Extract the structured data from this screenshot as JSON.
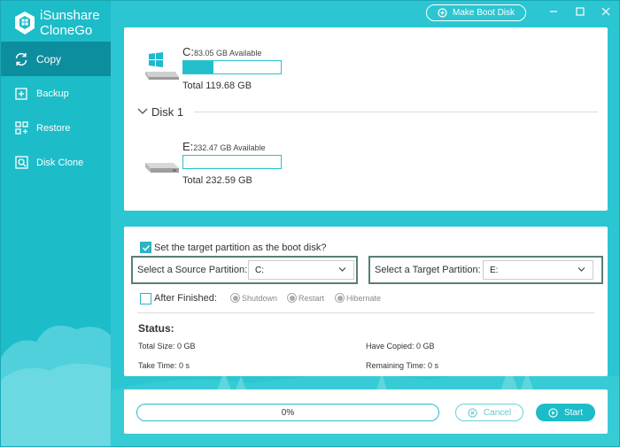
{
  "app": {
    "brand_line1": "iSunshare",
    "brand_line2": "CloneGo"
  },
  "sidebar": {
    "items": [
      {
        "label": "Copy",
        "icon": "copy-cycle-icon",
        "active": true
      },
      {
        "label": "Backup",
        "icon": "backup-plus-icon",
        "active": false
      },
      {
        "label": "Restore",
        "icon": "restore-grid-icon",
        "active": false
      },
      {
        "label": "Disk Clone",
        "icon": "disk-clone-icon",
        "active": false
      }
    ]
  },
  "topbar": {
    "boot_label": "Make Boot Disk"
  },
  "disks": {
    "c": {
      "letter": "C:",
      "available": "83.05 GB Available",
      "total": "Total 119.68 GB",
      "used_fraction": 0.31
    },
    "disk1_label": "Disk 1",
    "e": {
      "letter": "E:",
      "available": "232.47 GB Available",
      "total": "Total 232.59 GB",
      "used_fraction": 0.0
    }
  },
  "options": {
    "boot_check_label": "Set the target partition as the boot disk?",
    "boot_checked": true,
    "source_label": "Select a Source Partition:",
    "source_value": "C:",
    "target_label": "Select a Target Partition:",
    "target_value": "E:",
    "after_label": "After Finished:",
    "after_checked": false,
    "radios": [
      "Shutdown",
      "Restart",
      "Hibernate"
    ]
  },
  "status": {
    "title": "Status:",
    "total_size": "Total Size: 0 GB",
    "have_copied": "Have Copied: 0 GB",
    "take_time": "Take Time: 0 s",
    "remaining_time": "Remaining Time: 0 s"
  },
  "progress": {
    "percent_text": "0%",
    "value": 0,
    "cancel_label": "Cancel",
    "start_label": "Start"
  },
  "colors": {
    "sidebar": "#1cbcc9",
    "sidebar_active": "#0d8e9e",
    "main_bg": "#2bc6d1",
    "accent": "#22bfcb"
  }
}
